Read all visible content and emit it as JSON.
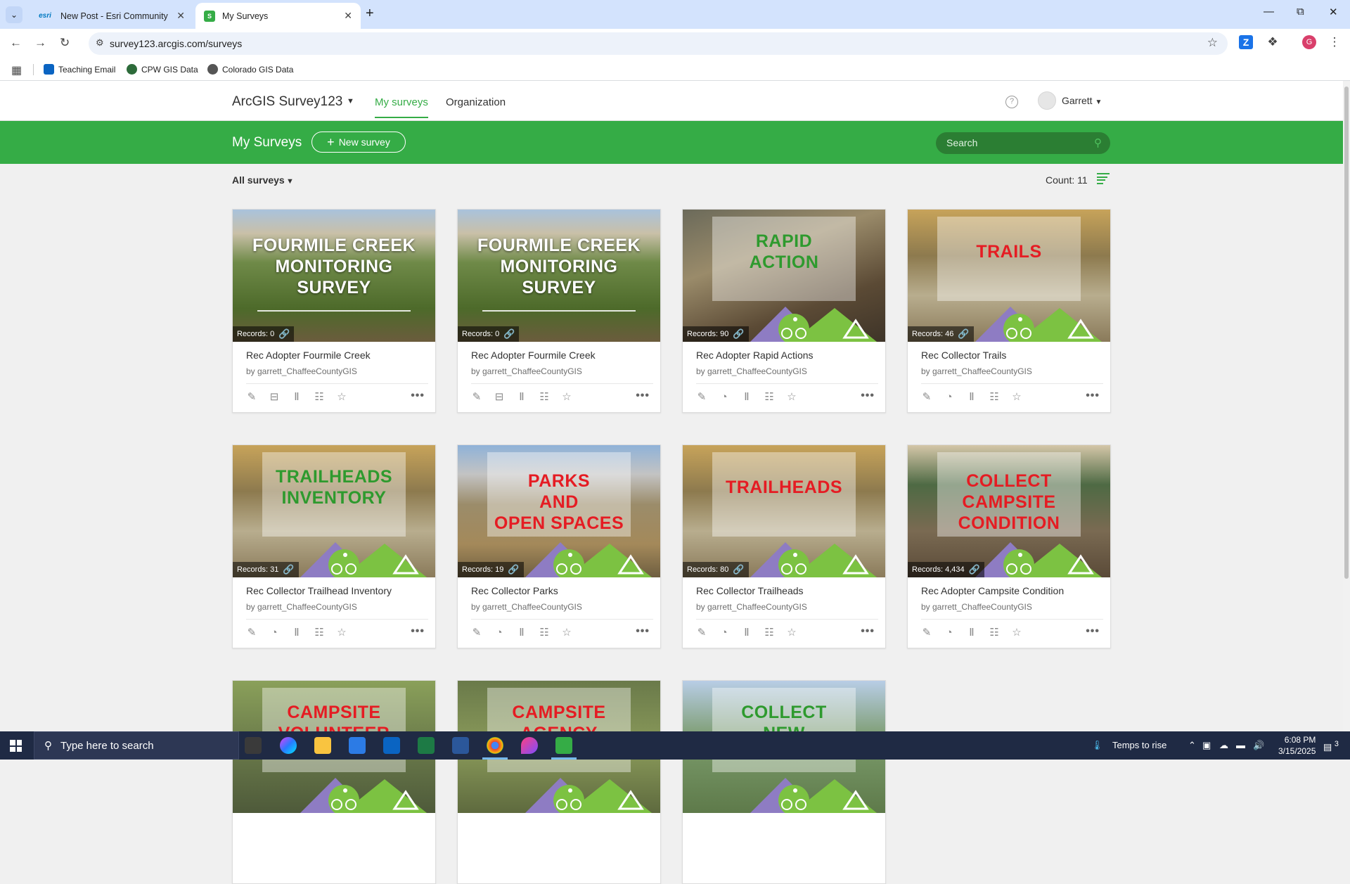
{
  "browser": {
    "tabs": [
      {
        "favicon": "esri",
        "title": "New Post - Esri Community"
      },
      {
        "favicon": "S",
        "title": "My Surveys"
      }
    ],
    "url": "survey123.arcgis.com/surveys",
    "bookmarks": [
      {
        "icon": "outlook-icon",
        "label": "Teaching Email"
      },
      {
        "icon": "cpw-icon",
        "label": "CPW GIS Data"
      },
      {
        "icon": "globe-icon",
        "label": "Colorado GIS Data"
      }
    ],
    "profile_initial": "G"
  },
  "app": {
    "brand": "ArcGIS Survey123",
    "nav": [
      "My surveys",
      "Organization"
    ],
    "help": "?",
    "user": "Garrett"
  },
  "toolbar": {
    "title": "My Surveys",
    "new_survey": "New survey",
    "search_placeholder": "Search"
  },
  "filter": {
    "label": "All surveys",
    "count": "Count: 11"
  },
  "surveys": [
    {
      "image_text": [
        "FOURMILE CREEK",
        "MONITORING",
        "SURVEY"
      ],
      "records": "Records: 0",
      "title": "Rec Adopter Fourmile Creek",
      "owner": "by garrett_ChaffeeCountyGIS"
    },
    {
      "image_text": [
        "FOURMILE CREEK",
        "MONITORING",
        "SURVEY"
      ],
      "records": "Records: 0",
      "title": "Rec Adopter Fourmile Creek",
      "owner": "by garrett_ChaffeeCountyGIS"
    },
    {
      "image_text": [
        "RAPID",
        "ACTION"
      ],
      "records": "Records: 90",
      "title": "Rec Adopter Rapid Actions",
      "owner": "by garrett_ChaffeeCountyGIS"
    },
    {
      "image_text": [
        "TRAILS"
      ],
      "records": "Records: 46",
      "title": "Rec Collector Trails",
      "owner": "by garrett_ChaffeeCountyGIS"
    },
    {
      "image_text": [
        "TRAILHEADS",
        "INVENTORY"
      ],
      "records": "Records: 31",
      "title": "Rec Collector Trailhead Inventory",
      "owner": "by garrett_ChaffeeCountyGIS"
    },
    {
      "image_text": [
        "PARKS",
        "AND",
        "OPEN SPACES"
      ],
      "records": "Records: 19",
      "title": "Rec Collector Parks",
      "owner": "by garrett_ChaffeeCountyGIS"
    },
    {
      "image_text": [
        "TRAILHEADS"
      ],
      "records": "Records: 80",
      "title": "Rec Collector Trailheads",
      "owner": "by garrett_ChaffeeCountyGIS"
    },
    {
      "image_text": [
        "COLLECT",
        "CAMPSITE",
        "CONDITION"
      ],
      "records": "Records: 4,434",
      "title": "Rec Adopter Campsite Condition",
      "owner": "by garrett_ChaffeeCountyGIS"
    },
    {
      "image_text": [
        "CAMPSITE",
        "VOLUNTEER"
      ]
    },
    {
      "image_text": [
        "CAMPSITE",
        "AGENCY"
      ]
    },
    {
      "image_text": [
        "COLLECT",
        "NEW"
      ]
    }
  ],
  "taskbar": {
    "search_placeholder": "Type here to search",
    "weather": "Temps to rise",
    "time": "6:08 PM",
    "date": "3/15/2025",
    "notifications": "3"
  },
  "colors": {
    "accent_green": "#35ac46",
    "title_red": "#e51c23",
    "title_green": "#2e9a2e"
  }
}
